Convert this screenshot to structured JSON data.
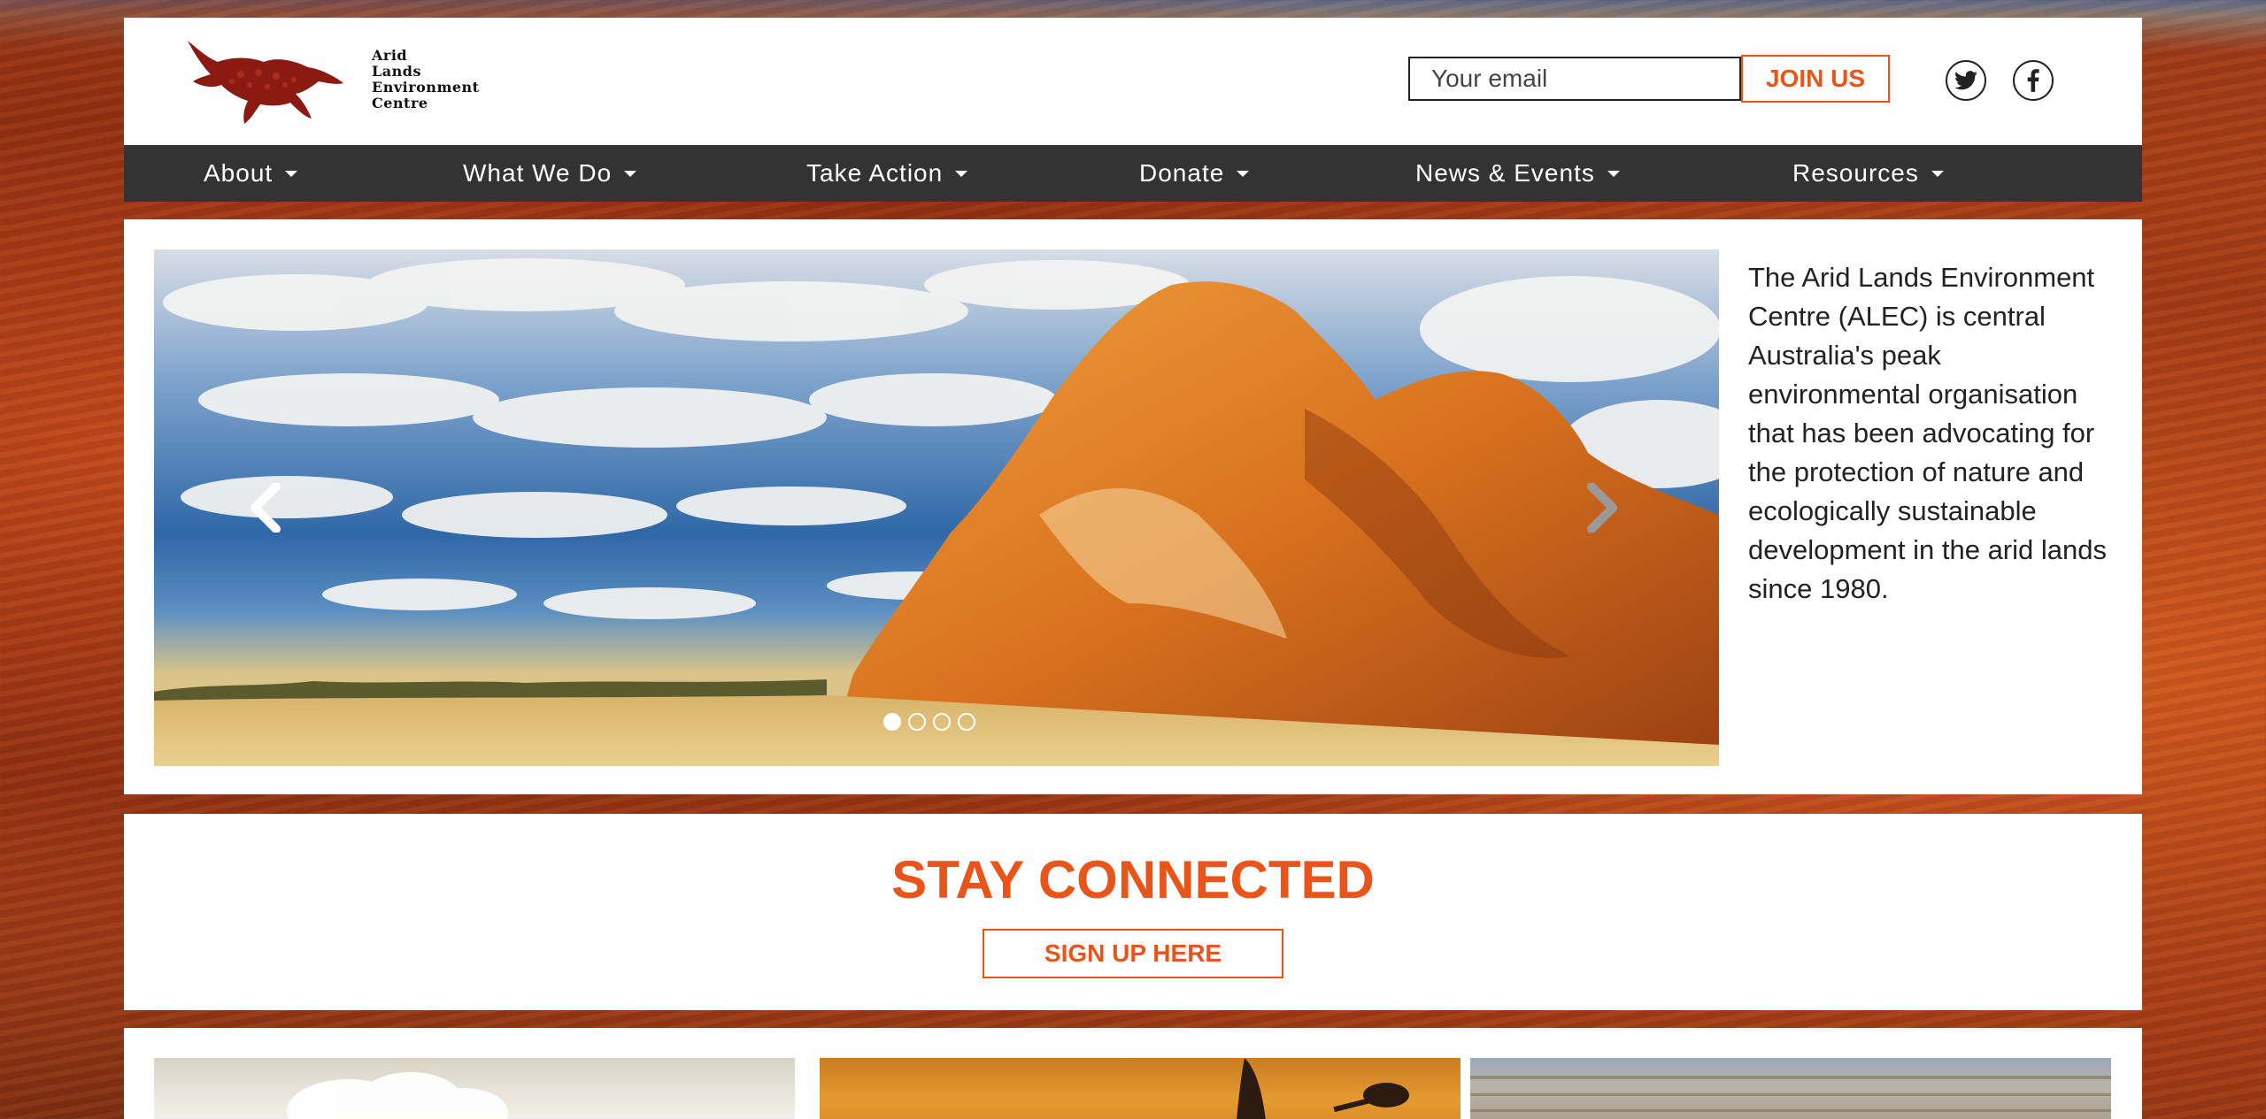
{
  "header": {
    "logo_lines": [
      "Arid",
      "Lands",
      "Environment",
      "Centre"
    ],
    "email_placeholder": "Your email",
    "join_label": "JOIN US",
    "social": [
      "twitter-icon",
      "facebook-icon"
    ]
  },
  "nav": {
    "items": [
      {
        "label": "About"
      },
      {
        "label": "What We Do"
      },
      {
        "label": "Take Action"
      },
      {
        "label": "Donate"
      },
      {
        "label": "News & Events"
      },
      {
        "label": "Resources"
      }
    ]
  },
  "hero": {
    "slide_count": 4,
    "active_slide": 1,
    "intro": "The Arid Lands Environment Centre (ALEC) is central Australia's peak environmental organisation that has been advocating for the protection of nature and ecologically sustainable development in the arid lands since 1980."
  },
  "connect": {
    "title": "STAY CONNECTED",
    "button_label": "SIGN UP HERE"
  },
  "colors": {
    "accent": "#e8541a",
    "nav_bg": "#333333"
  }
}
